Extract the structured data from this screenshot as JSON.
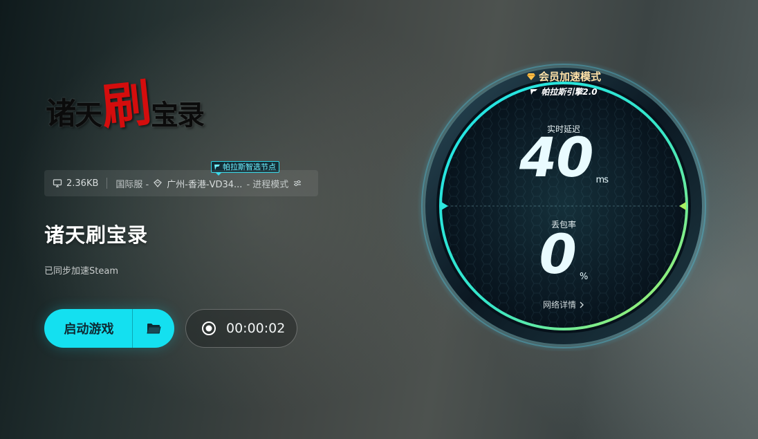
{
  "logo": {
    "chars": [
      "诸",
      "天",
      "刷",
      "宝",
      "录"
    ]
  },
  "node_tag": {
    "label": "帕拉斯智选节点"
  },
  "info_bar": {
    "traffic": "2.36KB",
    "server_region": "国际服 -",
    "route": "广州-香港-VD34...",
    "mode": "- 进程模式"
  },
  "game": {
    "title": "诸天刷宝录",
    "sync_text": "已同步加速Steam"
  },
  "launch": {
    "label": "启动游戏"
  },
  "timer": {
    "value": "00:00:02"
  },
  "gauge": {
    "vip_mode": "会员加速模式",
    "engine": "帕拉斯引擎2.0",
    "latency_label": "实时延迟",
    "latency_value": "40",
    "latency_unit": "ms",
    "loss_label": "丢包率",
    "loss_value": "0",
    "loss_unit": "%",
    "details_link": "网络详情"
  },
  "colors": {
    "accent": "#14e0f0",
    "vip_gold": "#ffc24a",
    "ring_start": "#1fe3ea",
    "ring_end": "#b6f25a"
  }
}
